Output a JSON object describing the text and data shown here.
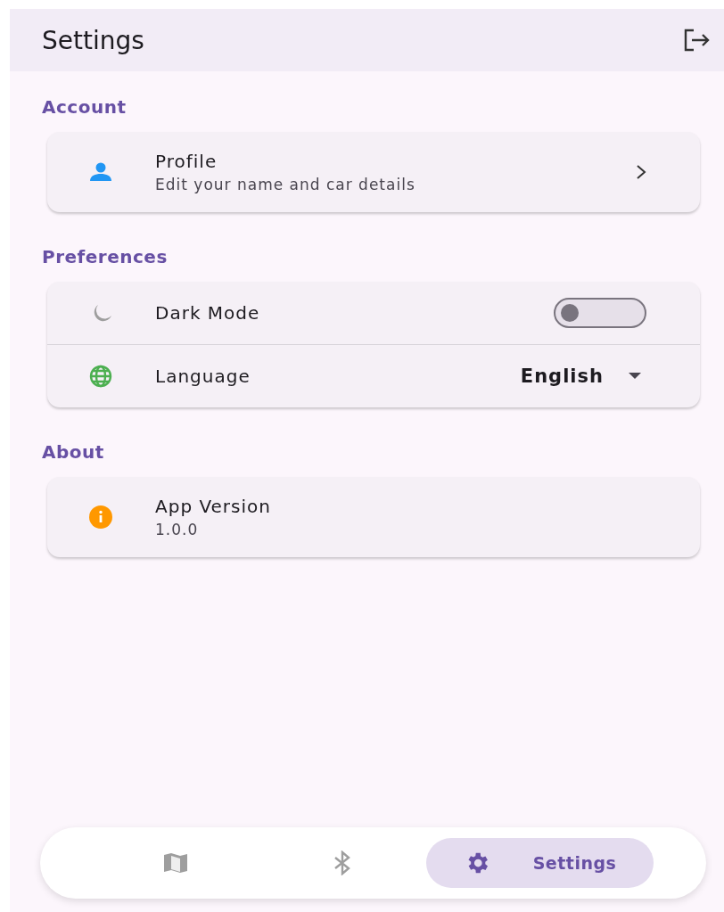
{
  "app_bar": {
    "title": "Settings"
  },
  "sections": [
    {
      "header": "Account",
      "rows": [
        {
          "kind": "link",
          "title": "Profile",
          "subtitle": "Edit your name and car details"
        }
      ]
    },
    {
      "header": "Preferences",
      "rows": [
        {
          "kind": "toggle",
          "title": "Dark Mode",
          "on": false
        },
        {
          "kind": "dropdown",
          "title": "Language",
          "value": "English"
        }
      ]
    },
    {
      "header": "About",
      "rows": [
        {
          "kind": "info",
          "title": "App Version",
          "subtitle": "1.0.0"
        }
      ]
    }
  ],
  "nav": [
    {
      "selected": false
    },
    {
      "selected": false
    },
    {
      "selected": true,
      "label": "Settings"
    }
  ]
}
